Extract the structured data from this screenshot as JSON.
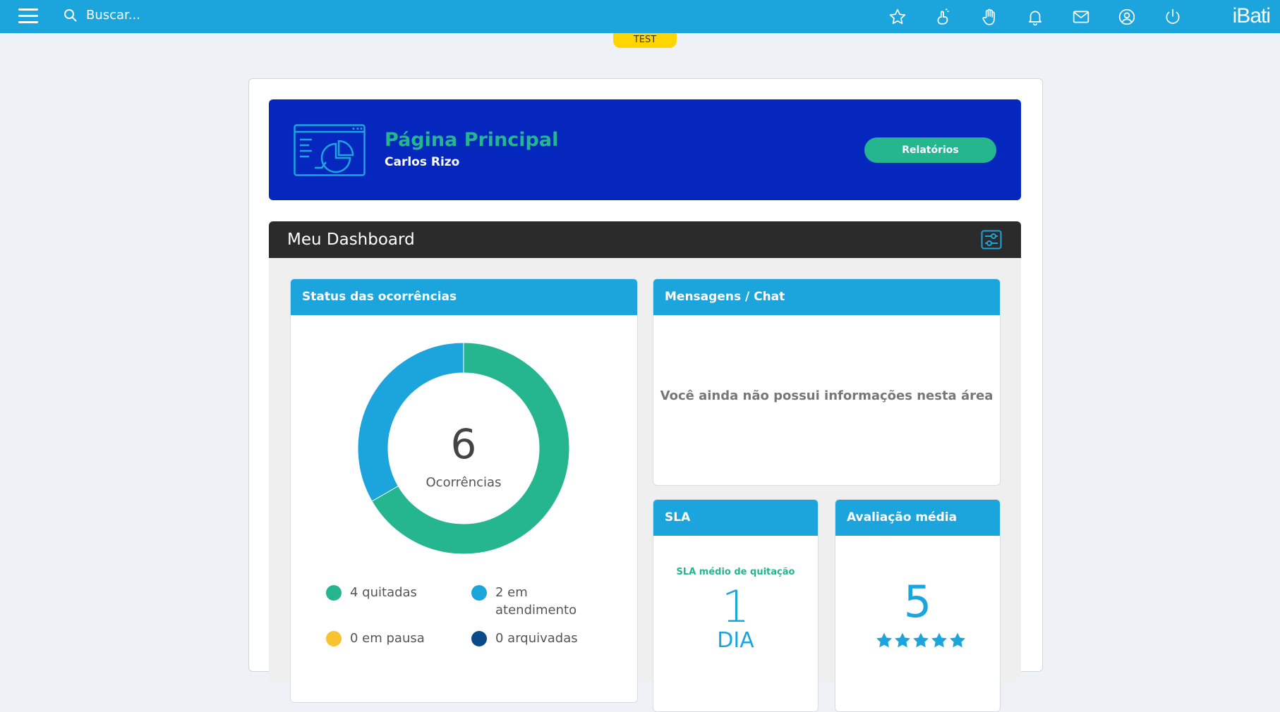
{
  "topbar": {
    "search_placeholder": "Buscar...",
    "brand": "iBati",
    "icons": [
      "star-icon",
      "finger-snap-icon",
      "hand-raise-icon",
      "bell-icon",
      "mail-icon",
      "user-circle-icon",
      "power-icon"
    ]
  },
  "env_badge": "TEST",
  "hero": {
    "title": "Página Principal",
    "subtitle": "Carlos Rizo",
    "button_label": "Relatórios"
  },
  "dashboard": {
    "title": "Meu Dashboard"
  },
  "status_panel": {
    "title": "Status das ocorrências",
    "total": "6",
    "total_label": "Ocorrências",
    "legend": [
      {
        "label": "4 quitadas",
        "color": "#25b58f"
      },
      {
        "label": "2 em atendimento",
        "color": "#1ca5dc"
      },
      {
        "label": "0 em pausa",
        "color": "#f7c331"
      },
      {
        "label": "0 arquivadas",
        "color": "#0b4a8a"
      }
    ]
  },
  "chart_data": {
    "type": "pie",
    "categories": [
      "quitadas",
      "em atendimento",
      "em pausa",
      "arquivadas"
    ],
    "values": [
      4,
      2,
      0,
      0
    ],
    "colors": [
      "#25b58f",
      "#1ca5dc",
      "#f7c331",
      "#0b4a8a"
    ],
    "title": "Status das ocorrências"
  },
  "messages_panel": {
    "title": "Mensagens / Chat",
    "empty_text": "Você ainda não possui informações nesta área"
  },
  "sla_panel": {
    "title": "SLA",
    "caption": "SLA médio de quitação",
    "value": "1",
    "unit": "DIA"
  },
  "rating_panel": {
    "title": "Avaliação média",
    "value": "5",
    "stars": 5
  },
  "colors": {
    "primary": "#1ca5dc",
    "hero_bg": "#0527bd",
    "accent_green": "#25b58f",
    "badge": "#ffd500"
  }
}
